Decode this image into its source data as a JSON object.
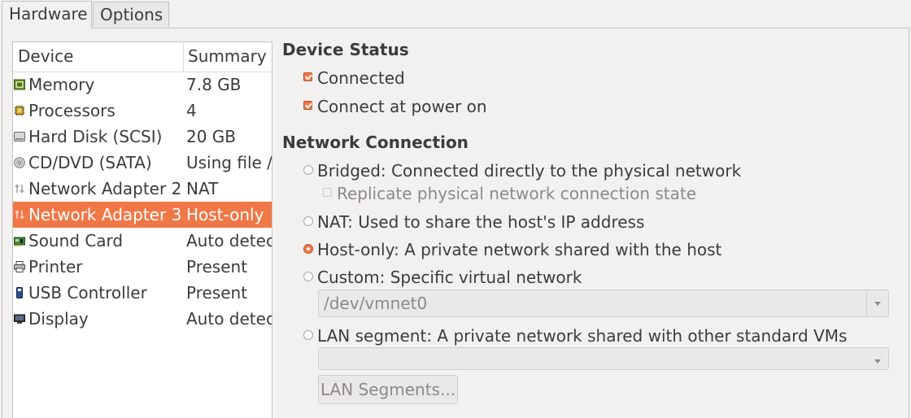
{
  "tabs": [
    {
      "label": "Hardware",
      "active": true
    },
    {
      "label": "Options",
      "active": false
    }
  ],
  "device_list": {
    "columns": {
      "device": "Device",
      "summary": "Summary"
    },
    "rows": [
      {
        "name": "Memory",
        "summary": "7.8 GB",
        "icon": "memory-icon"
      },
      {
        "name": "Processors",
        "summary": "4",
        "icon": "processor-icon"
      },
      {
        "name": "Hard Disk (SCSI)",
        "summary": "20 GB",
        "icon": "hard-disk-icon"
      },
      {
        "name": "CD/DVD (SATA)",
        "summary": "Using file /",
        "icon": "cd-dvd-icon"
      },
      {
        "name": "Network Adapter 2",
        "summary": "NAT",
        "icon": "network-adapter-icon"
      },
      {
        "name": "Network Adapter 3",
        "summary": "Host-only",
        "icon": "network-adapter-icon",
        "selected": true
      },
      {
        "name": "Sound Card",
        "summary": "Auto detec",
        "icon": "sound-card-icon"
      },
      {
        "name": "Printer",
        "summary": "Present",
        "icon": "printer-icon"
      },
      {
        "name": "USB Controller",
        "summary": "Present",
        "icon": "usb-icon"
      },
      {
        "name": "Display",
        "summary": "Auto detec",
        "icon": "display-icon"
      }
    ]
  },
  "device_status": {
    "title": "Device Status",
    "connected": {
      "label": "Connected",
      "checked": true
    },
    "connect_at_power_on": {
      "label": "Connect at power on",
      "checked": true
    }
  },
  "network_connection": {
    "title": "Network Connection",
    "bridged": {
      "label": "Bridged: Connected directly to the physical network",
      "selected": false
    },
    "replicate": {
      "label": "Replicate physical network connection state",
      "checked": false,
      "enabled": false
    },
    "nat": {
      "label": "NAT: Used to share the host's IP address",
      "selected": false
    },
    "host_only": {
      "label": "Host-only: A private network shared with the host",
      "selected": true
    },
    "custom": {
      "label": "Custom: Specific virtual network",
      "selected": false
    },
    "custom_network_value": "/dev/vmnet0",
    "lan_segment": {
      "label": "LAN segment: A private network shared with other standard VMs",
      "selected": false
    },
    "lan_segment_value": "",
    "lan_segments_button": "LAN Segments..."
  },
  "colors": {
    "accent": "#f07746",
    "background": "#f2f1f0"
  }
}
